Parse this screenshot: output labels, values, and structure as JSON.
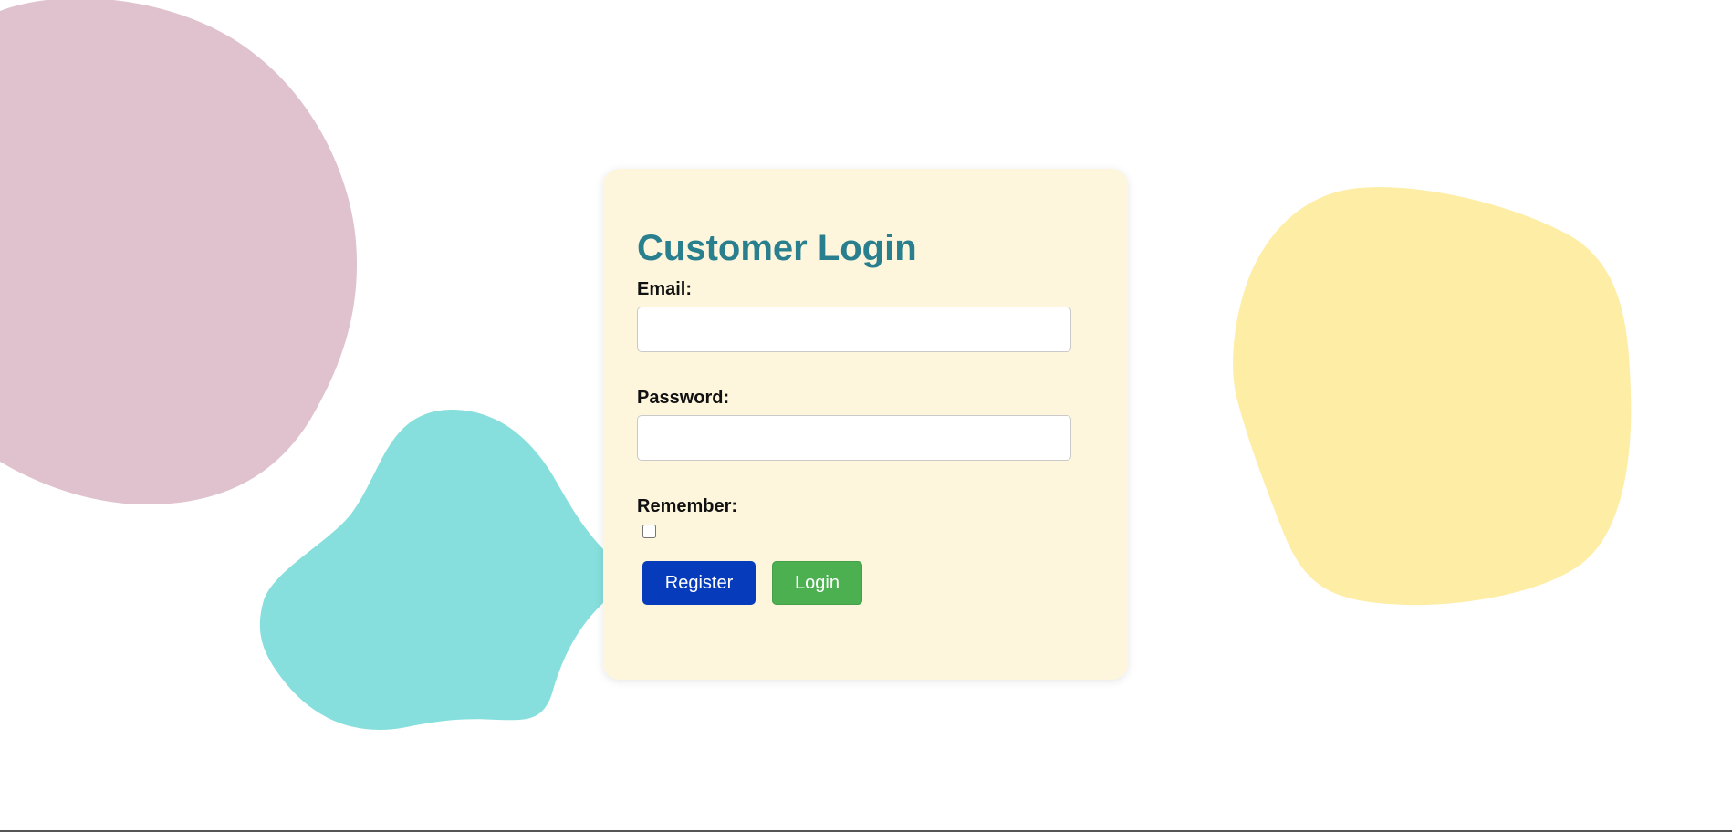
{
  "login": {
    "title": "Customer Login",
    "email_label": "Email:",
    "email_value": "",
    "password_label": "Password:",
    "password_value": "",
    "remember_label": "Remember:",
    "remember_checked": false,
    "register_label": "Register",
    "login_label": "Login"
  },
  "colors": {
    "page_background": "#ffffff",
    "card_background": "#fef6dc",
    "title_color": "#2a7f8f",
    "register_button": "#063bbb",
    "login_button": "#4caf50",
    "blob_pink": "#dfc2cd",
    "blob_teal": "#86dfdc",
    "blob_yellow": "#feeda5"
  }
}
